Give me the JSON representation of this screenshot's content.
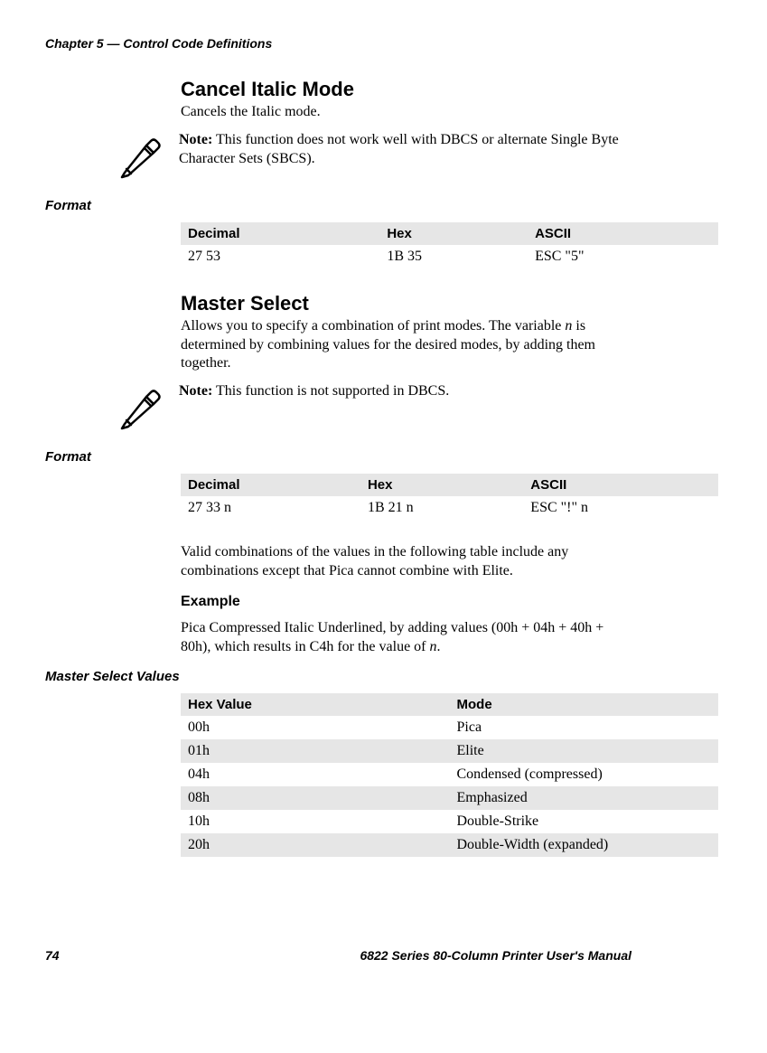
{
  "chapter_title": "Chapter 5 — Control Code Definitions",
  "section1": {
    "heading": "Cancel Italic Mode",
    "desc": "Cancels the Italic mode.",
    "note_bold": "Note:",
    "note_text": " This function does not work well with DBCS or alternate Single Byte Character Sets (SBCS)."
  },
  "format1_label": "Format",
  "table1": {
    "h1": "Decimal",
    "h2": "Hex",
    "h3": "ASCII",
    "r1c1": "27 53",
    "r1c2": "1B 35",
    "r1c3": "ESC \"5\""
  },
  "section2": {
    "heading": "Master Select",
    "desc_part1": "Allows you to specify a combination of print modes. The variable ",
    "desc_var": "n",
    "desc_part2": " is determined by combining values for the desired modes, by adding them together.",
    "note_bold": "Note:",
    "note_text": " This function is not supported in DBCS."
  },
  "format2_label": "Format",
  "table2": {
    "h1": "Decimal",
    "h2": "Hex",
    "h3": "ASCII",
    "r1c1": "27 33 n",
    "r1c2": "1B 21 n",
    "r1c3": "ESC \"!\" n"
  },
  "valid_para": "Valid combinations of the values in the following table include any combinations except that Pica cannot combine with Elite.",
  "example_heading": "Example",
  "example_para_part1": "Pica Compressed Italic Underlined, by adding values (00h + 04h + 40h + 80h), which results in C4h for the value of ",
  "example_var": "n",
  "example_para_part2": ".",
  "msv_label": "Master Select Values",
  "table3": {
    "h1": "Hex Value",
    "h2": "Mode",
    "rows": [
      {
        "c1": "00h",
        "c2": "Pica"
      },
      {
        "c1": "01h",
        "c2": "Elite"
      },
      {
        "c1": "04h",
        "c2": "Condensed (compressed)"
      },
      {
        "c1": "08h",
        "c2": "Emphasized"
      },
      {
        "c1": "10h",
        "c2": "Double-Strike"
      },
      {
        "c1": "20h",
        "c2": "Double-Width (expanded)"
      }
    ]
  },
  "footer": {
    "page": "74",
    "title": "6822 Series 80-Column Printer User's Manual"
  }
}
